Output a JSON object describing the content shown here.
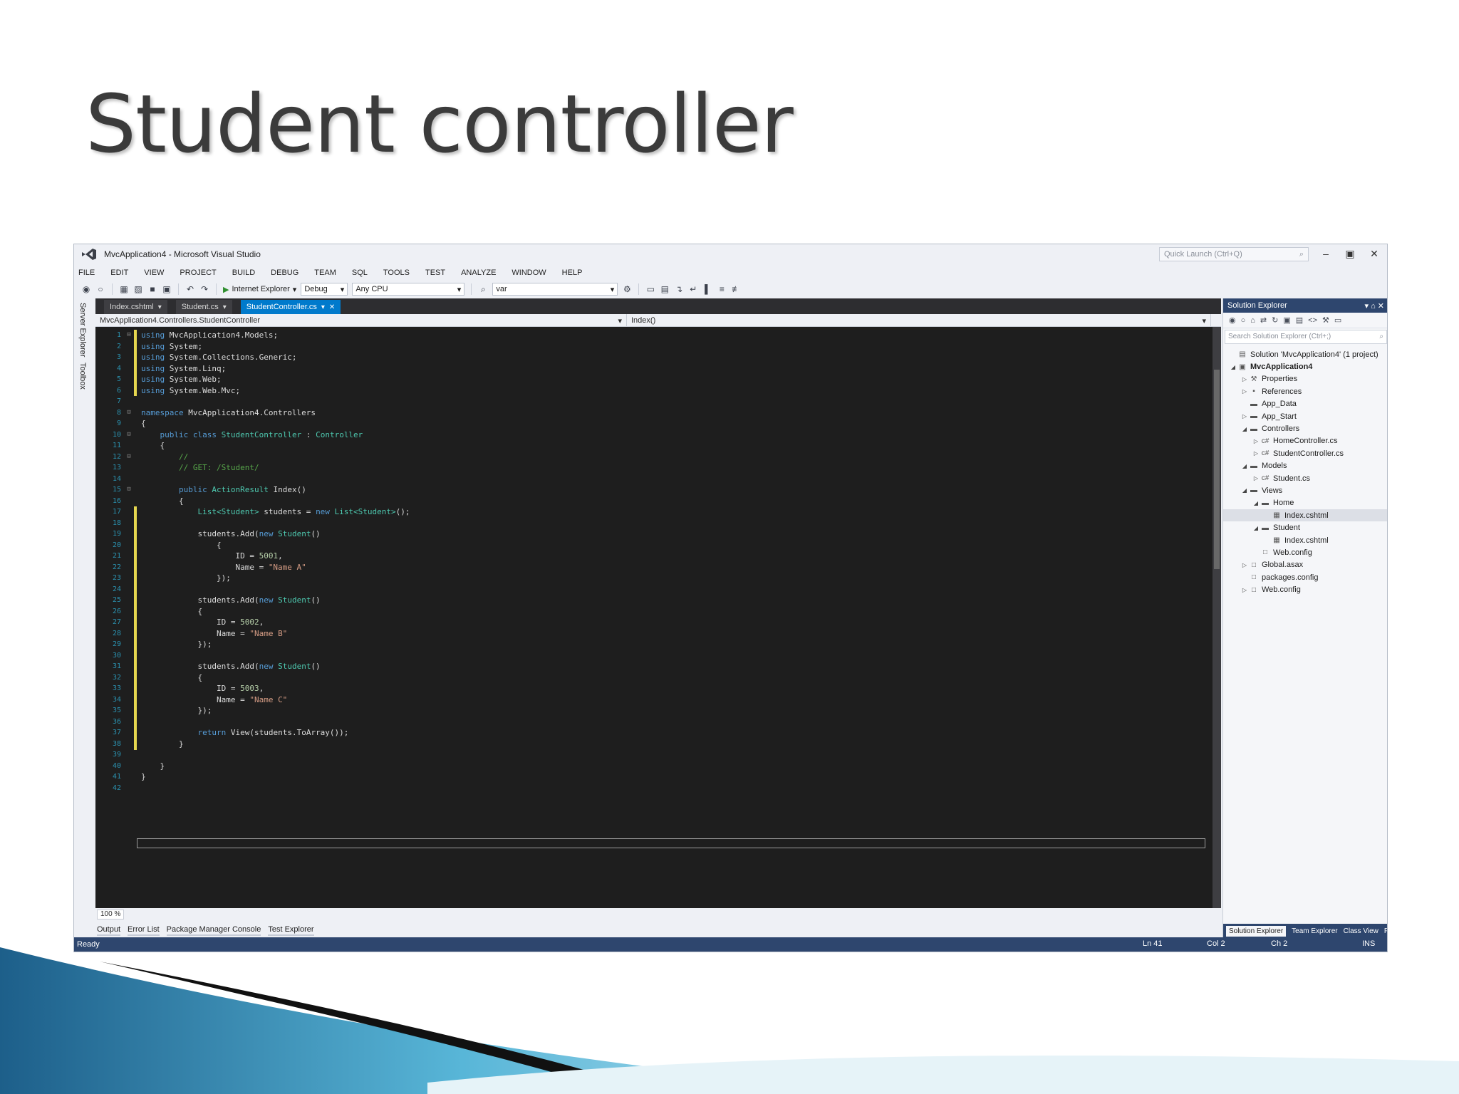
{
  "slide": {
    "title": "Student controller"
  },
  "window": {
    "title": "MvcApplication4 - Microsoft Visual Studio",
    "quick_launch_placeholder": "Quick Launch (Ctrl+Q)",
    "controls": [
      "–",
      "▣",
      "✕"
    ]
  },
  "menu": [
    "FILE",
    "EDIT",
    "VIEW",
    "PROJECT",
    "BUILD",
    "DEBUG",
    "TEAM",
    "SQL",
    "TOOLS",
    "TEST",
    "ANALYZE",
    "WINDOW",
    "HELP"
  ],
  "toolbar": {
    "run_label": "Internet Explorer",
    "config": "Debug",
    "platform": "Any CPU",
    "find_value": "var"
  },
  "left_strip": [
    "Server Explorer",
    "Toolbox"
  ],
  "doc_tabs": [
    {
      "label": "Index.cshtml",
      "active": false
    },
    {
      "label": "Student.cs",
      "active": false
    },
    {
      "label": "StudentController.cs",
      "active": true
    }
  ],
  "navbar": {
    "left": "MvcApplication4.Controllers.StudentController",
    "right": "Index()"
  },
  "code_lines": [
    [
      [
        "kw",
        "using"
      ],
      [
        "pl",
        " MvcApplication4.Models;"
      ]
    ],
    [
      [
        "kw",
        "using"
      ],
      [
        "pl",
        " System;"
      ]
    ],
    [
      [
        "kw",
        "using"
      ],
      [
        "pl",
        " System.Collections.Generic;"
      ]
    ],
    [
      [
        "kw",
        "using"
      ],
      [
        "pl",
        " System.Linq;"
      ]
    ],
    [
      [
        "kw",
        "using"
      ],
      [
        "pl",
        " System.Web;"
      ]
    ],
    [
      [
        "kw",
        "using"
      ],
      [
        "pl",
        " System.Web.Mvc;"
      ]
    ],
    [],
    [
      [
        "kw",
        "namespace"
      ],
      [
        "pl",
        " MvcApplication4.Controllers"
      ]
    ],
    [
      [
        "pl",
        "{"
      ]
    ],
    [
      [
        "pl",
        "    "
      ],
      [
        "kw",
        "public class"
      ],
      [
        "pl",
        " "
      ],
      [
        "ty",
        "StudentController"
      ],
      [
        "pl",
        " : "
      ],
      [
        "ty",
        "Controller"
      ]
    ],
    [
      [
        "pl",
        "    {"
      ]
    ],
    [
      [
        "pl",
        "        "
      ],
      [
        "cm",
        "//"
      ]
    ],
    [
      [
        "pl",
        "        "
      ],
      [
        "cm",
        "// GET: /Student/"
      ]
    ],
    [],
    [
      [
        "pl",
        "        "
      ],
      [
        "kw",
        "public"
      ],
      [
        "pl",
        " "
      ],
      [
        "ty",
        "ActionResult"
      ],
      [
        "pl",
        " Index()"
      ]
    ],
    [
      [
        "pl",
        "        {"
      ]
    ],
    [
      [
        "pl",
        "            "
      ],
      [
        "ty",
        "List<Student>"
      ],
      [
        "pl",
        " students = "
      ],
      [
        "kw",
        "new"
      ],
      [
        "pl",
        " "
      ],
      [
        "ty",
        "List<Student>"
      ],
      [
        "pl",
        "();"
      ]
    ],
    [],
    [
      [
        "pl",
        "            students.Add("
      ],
      [
        "kw",
        "new"
      ],
      [
        "pl",
        " "
      ],
      [
        "ty",
        "Student"
      ],
      [
        "pl",
        "()"
      ]
    ],
    [
      [
        "pl",
        "                {"
      ]
    ],
    [
      [
        "pl",
        "                    ID = "
      ],
      [
        "nu",
        "5001"
      ],
      [
        "pl",
        ","
      ]
    ],
    [
      [
        "pl",
        "                    Name = "
      ],
      [
        "st",
        "\"Name A\""
      ]
    ],
    [
      [
        "pl",
        "                });"
      ]
    ],
    [],
    [
      [
        "pl",
        "            students.Add("
      ],
      [
        "kw",
        "new"
      ],
      [
        "pl",
        " "
      ],
      [
        "ty",
        "Student"
      ],
      [
        "pl",
        "()"
      ]
    ],
    [
      [
        "pl",
        "            {"
      ]
    ],
    [
      [
        "pl",
        "                ID = "
      ],
      [
        "nu",
        "5002"
      ],
      [
        "pl",
        ","
      ]
    ],
    [
      [
        "pl",
        "                Name = "
      ],
      [
        "st",
        "\"Name B\""
      ]
    ],
    [
      [
        "pl",
        "            });"
      ]
    ],
    [],
    [
      [
        "pl",
        "            students.Add("
      ],
      [
        "kw",
        "new"
      ],
      [
        "pl",
        " "
      ],
      [
        "ty",
        "Student"
      ],
      [
        "pl",
        "()"
      ]
    ],
    [
      [
        "pl",
        "            {"
      ]
    ],
    [
      [
        "pl",
        "                ID = "
      ],
      [
        "nu",
        "5003"
      ],
      [
        "pl",
        ","
      ]
    ],
    [
      [
        "pl",
        "                Name = "
      ],
      [
        "st",
        "\"Name C\""
      ]
    ],
    [
      [
        "pl",
        "            });"
      ]
    ],
    [],
    [
      [
        "pl",
        "            "
      ],
      [
        "kw",
        "return"
      ],
      [
        "pl",
        " View(students.ToArray());"
      ]
    ],
    [
      [
        "pl",
        "        }"
      ]
    ],
    [],
    [
      [
        "pl",
        "    }"
      ]
    ],
    [
      [
        "pl",
        "}"
      ]
    ],
    []
  ],
  "zoom": "100 %",
  "bottom_tabs": [
    "Output",
    "Error List",
    "Package Manager Console",
    "Test Explorer"
  ],
  "status": {
    "ready": "Ready",
    "line": "Ln 41",
    "col": "Col 2",
    "ch": "Ch 2",
    "mode": "INS"
  },
  "solution_explorer": {
    "header": "Solution Explorer",
    "header_pins": "▾ ⌂ ✕",
    "search_placeholder": "Search Solution Explorer (Ctrl+;)",
    "tree": [
      {
        "label": "Solution 'MvcApplication4' (1 project)",
        "depth": 0,
        "toggle": "",
        "icon": "solution-icon",
        "glyph": "▤",
        "bold": false
      },
      {
        "label": "MvcApplication4",
        "depth": 0,
        "toggle": "◢",
        "icon": "project-icon",
        "glyph": "▣",
        "bold": true
      },
      {
        "label": "Properties",
        "depth": 1,
        "toggle": "▷",
        "icon": "wrench-icon",
        "glyph": "⚒",
        "bold": false
      },
      {
        "label": "References",
        "depth": 1,
        "toggle": "▷",
        "icon": "references-icon",
        "glyph": "▪",
        "bold": false
      },
      {
        "label": "App_Data",
        "depth": 1,
        "toggle": "",
        "icon": "folder-icon",
        "glyph": "▬",
        "bold": false
      },
      {
        "label": "App_Start",
        "depth": 1,
        "toggle": "▷",
        "icon": "folder-icon",
        "glyph": "▬",
        "bold": false
      },
      {
        "label": "Controllers",
        "depth": 1,
        "toggle": "◢",
        "icon": "folder-icon",
        "glyph": "▬",
        "bold": false
      },
      {
        "label": "HomeController.cs",
        "depth": 2,
        "toggle": "▷",
        "icon": "csharp-file-icon",
        "glyph": "c#",
        "bold": false
      },
      {
        "label": "StudentController.cs",
        "depth": 2,
        "toggle": "▷",
        "icon": "csharp-file-icon",
        "glyph": "c#",
        "bold": false
      },
      {
        "label": "Models",
        "depth": 1,
        "toggle": "◢",
        "icon": "folder-icon",
        "glyph": "▬",
        "bold": false
      },
      {
        "label": "Student.cs",
        "depth": 2,
        "toggle": "▷",
        "icon": "csharp-file-icon",
        "glyph": "c#",
        "bold": false
      },
      {
        "label": "Views",
        "depth": 1,
        "toggle": "◢",
        "icon": "folder-icon",
        "glyph": "▬",
        "bold": false
      },
      {
        "label": "Home",
        "depth": 2,
        "toggle": "◢",
        "icon": "folder-icon",
        "glyph": "▬",
        "bold": false
      },
      {
        "label": "Index.cshtml",
        "depth": 3,
        "toggle": "",
        "icon": "cshtml-file-icon",
        "glyph": "▦",
        "bold": false,
        "selected": true
      },
      {
        "label": "Student",
        "depth": 2,
        "toggle": "◢",
        "icon": "folder-icon",
        "glyph": "▬",
        "bold": false
      },
      {
        "label": "Index.cshtml",
        "depth": 3,
        "toggle": "",
        "icon": "cshtml-file-icon",
        "glyph": "▦",
        "bold": false
      },
      {
        "label": "Web.config",
        "depth": 2,
        "toggle": "",
        "icon": "config-file-icon",
        "glyph": "□",
        "bold": false
      },
      {
        "label": "Global.asax",
        "depth": 1,
        "toggle": "▷",
        "icon": "config-file-icon",
        "glyph": "□",
        "bold": false
      },
      {
        "label": "packages.config",
        "depth": 1,
        "toggle": "",
        "icon": "config-file-icon",
        "glyph": "□",
        "bold": false
      },
      {
        "label": "Web.config",
        "depth": 1,
        "toggle": "▷",
        "icon": "config-file-icon",
        "glyph": "□",
        "bold": false
      }
    ],
    "bottom_tabs": [
      {
        "label": "Solution Explorer",
        "active": true
      },
      {
        "label": "Team Explorer",
        "active": false
      },
      {
        "label": "Class View",
        "active": false
      },
      {
        "label": "Properties",
        "active": false
      }
    ]
  },
  "colors": {
    "keyword": "#569cd6",
    "type": "#4ec9b0",
    "string": "#d69d85",
    "number": "#b5cea8",
    "comment": "#57a64a",
    "status_bar": "#2e466e",
    "active_tab": "#007acc"
  }
}
